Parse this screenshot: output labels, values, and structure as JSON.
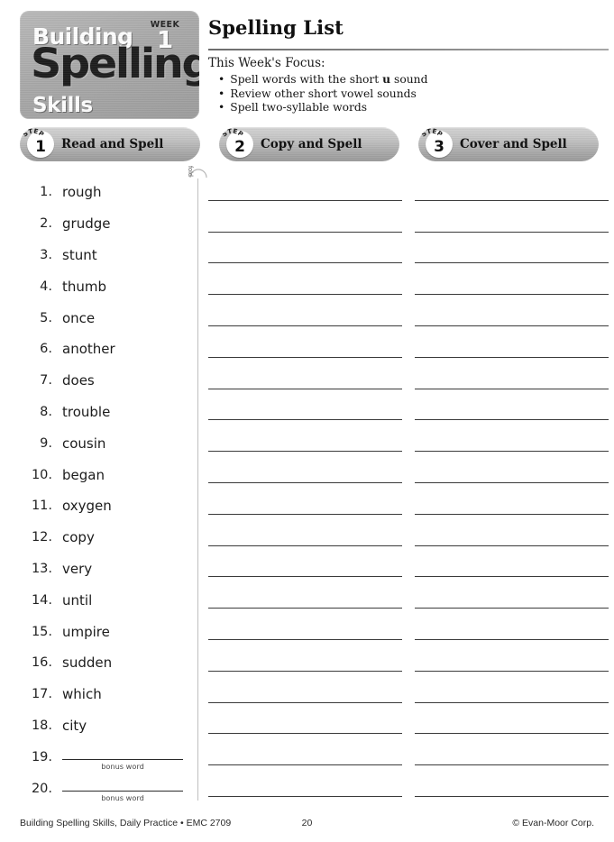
{
  "masthead": {
    "line1": "Building",
    "line2": "Spelling",
    "line3": "Skills",
    "week_label": "WEEK",
    "week_number": "1"
  },
  "header": {
    "title": "Spelling List",
    "focus_heading": "This Week's Focus:",
    "focus_items": [
      {
        "pre": "Spell words with the short ",
        "strong": "u",
        "post": " sound"
      },
      {
        "pre": "Review other short vowel sounds",
        "strong": "",
        "post": ""
      },
      {
        "pre": "Spell two-syllable words",
        "strong": "",
        "post": ""
      }
    ]
  },
  "steps": [
    {
      "step_word": "STEP",
      "number": "1",
      "label": "Read and Spell"
    },
    {
      "step_word": "STEP",
      "number": "2",
      "label": "Copy and Spell"
    },
    {
      "step_word": "STEP",
      "number": "3",
      "label": "Cover and Spell"
    }
  ],
  "fold": {
    "label": "fold"
  },
  "words": [
    {
      "num": "1.",
      "word": "rough"
    },
    {
      "num": "2.",
      "word": "grudge"
    },
    {
      "num": "3.",
      "word": "stunt"
    },
    {
      "num": "4.",
      "word": "thumb"
    },
    {
      "num": "5.",
      "word": "once"
    },
    {
      "num": "6.",
      "word": "another"
    },
    {
      "num": "7.",
      "word": "does"
    },
    {
      "num": "8.",
      "word": "trouble"
    },
    {
      "num": "9.",
      "word": "cousin"
    },
    {
      "num": "10.",
      "word": "began"
    },
    {
      "num": "11.",
      "word": "oxygen"
    },
    {
      "num": "12.",
      "word": "copy"
    },
    {
      "num": "13.",
      "word": "very"
    },
    {
      "num": "14.",
      "word": "until"
    },
    {
      "num": "15.",
      "word": "umpire"
    },
    {
      "num": "16.",
      "word": "sudden"
    },
    {
      "num": "17.",
      "word": "which"
    },
    {
      "num": "18.",
      "word": "city"
    },
    {
      "num": "19.",
      "word": "",
      "bonus_caption": "bonus word"
    },
    {
      "num": "20.",
      "word": "",
      "bonus_caption": "bonus word"
    }
  ],
  "writing_lines": {
    "rows": 20,
    "columns": 2
  },
  "footer": {
    "left": "Building Spelling Skills, Daily Practice • EMC 2709",
    "center": "20",
    "right": "© Evan-Moor Corp."
  },
  "colors": {
    "panel_gray": "#b0b0b0",
    "rule_dark": "#3a3a3a",
    "text_dark": "#1a1a1a",
    "fold_line": "#c0c0c0"
  }
}
